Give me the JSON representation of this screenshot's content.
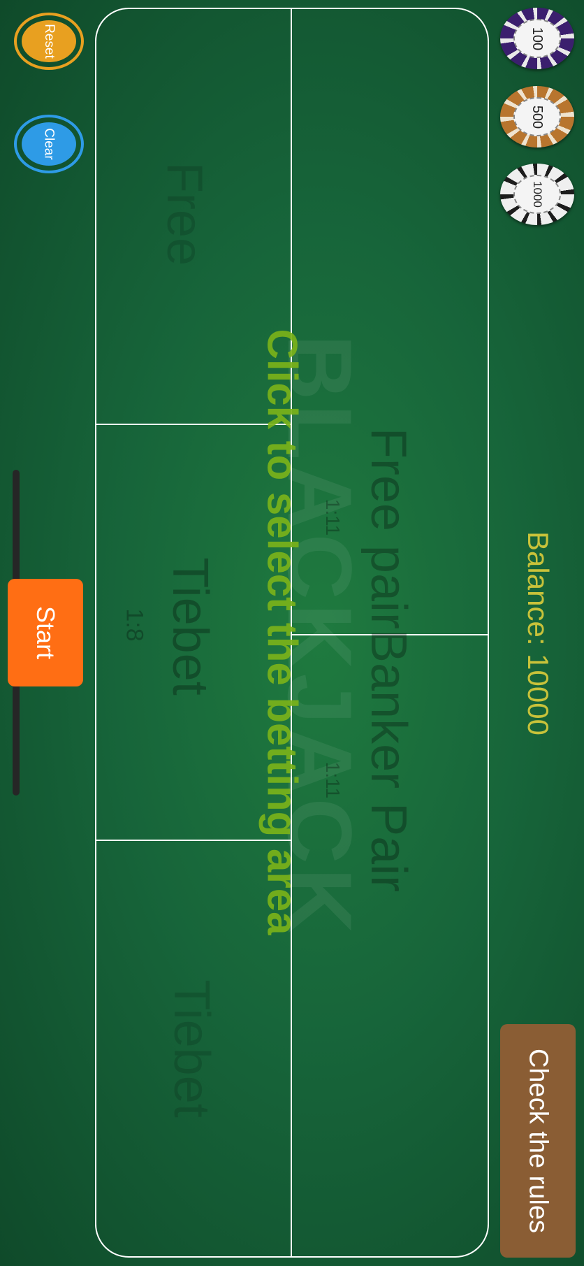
{
  "controls": {
    "reset_label": "Reset",
    "clear_label": "Clear",
    "start_label": "Start",
    "rules_label": "Check the rules"
  },
  "balance": {
    "text": "Balance: 10000"
  },
  "chips": [
    {
      "value": "100",
      "color": "#3b1f6e"
    },
    {
      "value": "500",
      "color": "#b8752e"
    },
    {
      "value": "1000",
      "color": "#efefef"
    }
  ],
  "table": {
    "watermark": "BLACKJACK",
    "instruction": "Click to select the betting area",
    "zones": {
      "free_pair_banker_pair": "Free pairBanker Pair",
      "free_pair_odds": "1:11",
      "banker_pair_odds": "1:11",
      "tiebet_label": "Tiebet",
      "tiebet_odds": "1:8",
      "left_free": "Free",
      "left_tiebet": "Tiebet"
    }
  },
  "colors": {
    "reset": "#e8a020",
    "clear": "#2e9be6",
    "start": "#ff6e14",
    "rules": "#8a5d34",
    "balance": "#c8c23a",
    "instruction": "#7fb51e"
  }
}
